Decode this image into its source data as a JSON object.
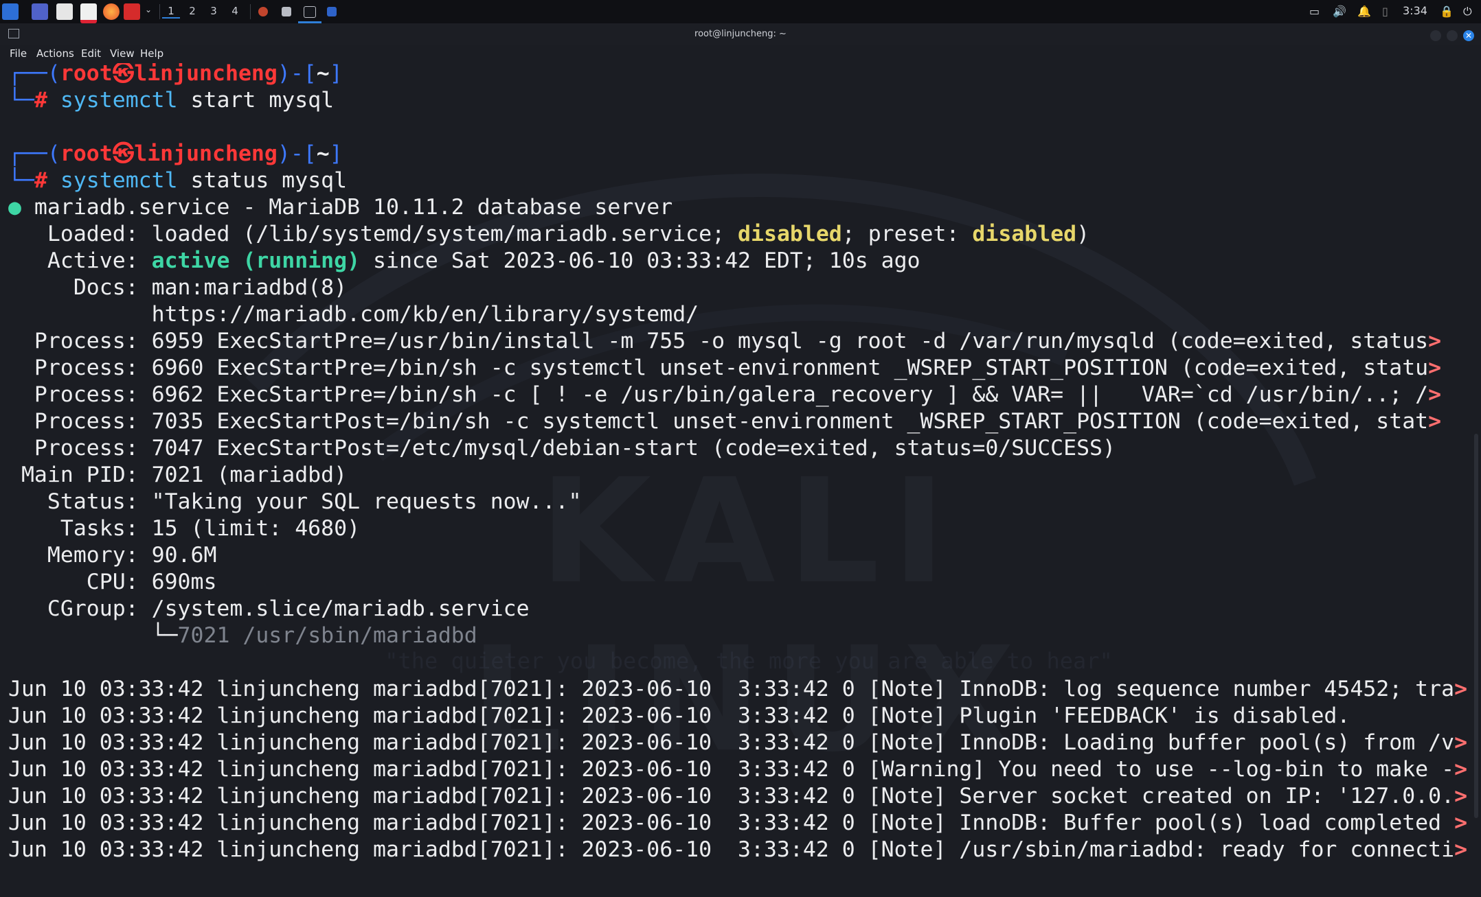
{
  "taskbar": {
    "workspaces": [
      "1",
      "2",
      "3",
      "4"
    ],
    "clock": "3:34"
  },
  "window": {
    "title": "root@linjuncheng: ~"
  },
  "menu": [
    "File",
    "Actions",
    "Edit",
    "View",
    "Help"
  ],
  "prompt": {
    "user": "root",
    "symbol": "㉿",
    "host": "linjuncheng",
    "cwd": "~",
    "hash": "#"
  },
  "commands": [
    {
      "cmd": "systemctl",
      "args": " start mysql"
    },
    {
      "cmd": "systemctl",
      "args": " status mysql"
    }
  ],
  "status": {
    "header": " mariadb.service - MariaDB 10.11.2 database server",
    "loaded_label": "   Loaded: ",
    "loaded_a": "loaded (/lib/systemd/system/mariadb.service; ",
    "loaded_b": "disabled",
    "loaded_c": "; preset: ",
    "loaded_d": "disabled",
    "loaded_e": ")",
    "active_label": "   Active: ",
    "active_state": "active (running)",
    "active_rest": " since Sat 2023-06-10 03:33:42 EDT; 10s ago",
    "docs_1": "     Docs: man:mariadbd(8)",
    "docs_2": "           https://mariadb.com/kb/en/library/systemd/",
    "process_lines": [
      "  Process: 6959 ExecStartPre=/usr/bin/install -m 755 -o mysql -g root -d /var/run/mysqld (code=exited, status",
      "  Process: 6960 ExecStartPre=/bin/sh -c systemctl unset-environment _WSREP_START_POSITION (code=exited, statu",
      "  Process: 6962 ExecStartPre=/bin/sh -c [ ! -e /usr/bin/galera_recovery ] && VAR= ||   VAR=`cd /usr/bin/..; /",
      "  Process: 7035 ExecStartPost=/bin/sh -c systemctl unset-environment _WSREP_START_POSITION (code=exited, stat",
      "  Process: 7047 ExecStartPost=/etc/mysql/debian-start (code=exited, status=0/SUCCESS)"
    ],
    "main_pid": " Main PID: 7021 (mariadbd)",
    "status_line": "   Status: \"Taking your SQL requests now...\"",
    "tasks": "    Tasks: 15 (limit: 4680)",
    "memory": "   Memory: 90.6M",
    "cpu": "      CPU: 690ms",
    "cgroup": "   CGroup: /system.slice/mariadb.service",
    "cgroup_child_prefix": "           └─",
    "cgroup_child": "7021 /usr/sbin/mariadbd"
  },
  "log_lines": [
    "Jun 10 03:33:42 linjuncheng mariadbd[7021]: 2023-06-10  3:33:42 0 [Note] InnoDB: log sequence number 45452; tra",
    "Jun 10 03:33:42 linjuncheng mariadbd[7021]: 2023-06-10  3:33:42 0 [Note] Plugin 'FEEDBACK' is disabled.",
    "Jun 10 03:33:42 linjuncheng mariadbd[7021]: 2023-06-10  3:33:42 0 [Note] InnoDB: Loading buffer pool(s) from /v",
    "Jun 10 03:33:42 linjuncheng mariadbd[7021]: 2023-06-10  3:33:42 0 [Warning] You need to use --log-bin to make -",
    "Jun 10 03:33:42 linjuncheng mariadbd[7021]: 2023-06-10  3:33:42 0 [Note] Server socket created on IP: '127.0.0.",
    "Jun 10 03:33:42 linjuncheng mariadbd[7021]: 2023-06-10  3:33:42 0 [Note] InnoDB: Buffer pool(s) load completed ",
    "Jun 10 03:33:42 linjuncheng mariadbd[7021]: 2023-06-10  3:33:42 0 [Note] /usr/sbin/mariadbd: ready for connecti"
  ],
  "truncation_marker": ">",
  "truncated_lines": [
    true,
    true,
    true,
    true,
    false
  ],
  "truncated_logs": [
    true,
    false,
    true,
    true,
    true,
    true,
    true
  ],
  "watermark": {
    "title": "KALI LINUX",
    "subtitle": "\"the quieter you become, the more you are able to hear\""
  }
}
